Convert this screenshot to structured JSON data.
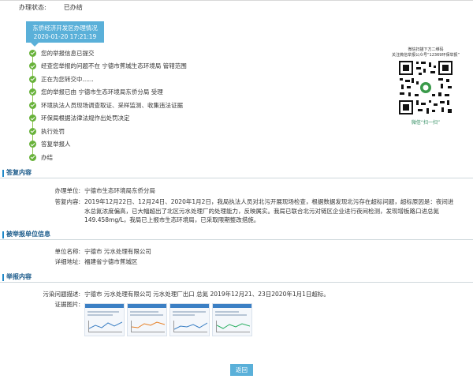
{
  "status": {
    "label": "办理状态:",
    "value": "已办结"
  },
  "timeline": {
    "header_line1": "东侨经济开发区办理情况",
    "header_line2": "2020-01-20 17:21:19",
    "steps": [
      {
        "label": "您的举报信息已提交"
      },
      {
        "label": "经查您举报的问题不在 宁德市蕉城生态环境局 管辖范围"
      },
      {
        "label": "正在为您转交中......"
      },
      {
        "label": "您的举报已由 宁德市生态环境局东侨分局 受理"
      },
      {
        "label": "环境执法人员现场调查取证、采样监测、收集违法证据"
      },
      {
        "label": "环保局根据法律法规作出处罚决定"
      },
      {
        "label": "执行处罚"
      },
      {
        "label": "答复举报人"
      },
      {
        "label": "办结"
      }
    ],
    "step_color": "#68b23a"
  },
  "qr": {
    "caption_line1": "微信扫描下方二维码",
    "caption_line2": "关注微信举报公众号“12369环保举报”",
    "footer": "微信“扫一扫”"
  },
  "reply_section": {
    "title": "答复内容",
    "unit_label": "办理单位:",
    "unit_value": "宁德市生态环境局东侨分局",
    "content_label": "答复内容:",
    "content_value": "2019年12月22日、12月24日、2020年1月2日，我局执法人员对北污开展现场检查，根据数据发现北污存在超标问题，超标原因是：夜间进水总氮浓度偏高，已大幅超出了北区污水处理厂的处理能力，反映属实。我局已联合北污对链区企业进行夜间检测，发现增板路口进总氮149.458mg/L，我局已上报市生态环境局，已采取限期整改措施。"
  },
  "reported_unit_section": {
    "title": "被举报单位信息",
    "name_label": "单位名称:",
    "name_value": "宁德市         污水处理有限公司",
    "address_label": "详细地址:",
    "address_value": "福建省宁德市蕉城区"
  },
  "report_section": {
    "title": "举报内容",
    "desc_label": "污染问题描述:",
    "desc_value": "宁德市          污水处理有限公司 污水处理厂出口 总氮 2019年12月21、23日2020年1月1日超标。",
    "photos_label": "证据图片:"
  },
  "back_button": {
    "label": "返回"
  },
  "colors": {
    "accent": "#5ab0d9",
    "section_title": "#1a5a8a",
    "section_bar": "#1e88c8",
    "qr_footer": "#2b8a5d"
  }
}
